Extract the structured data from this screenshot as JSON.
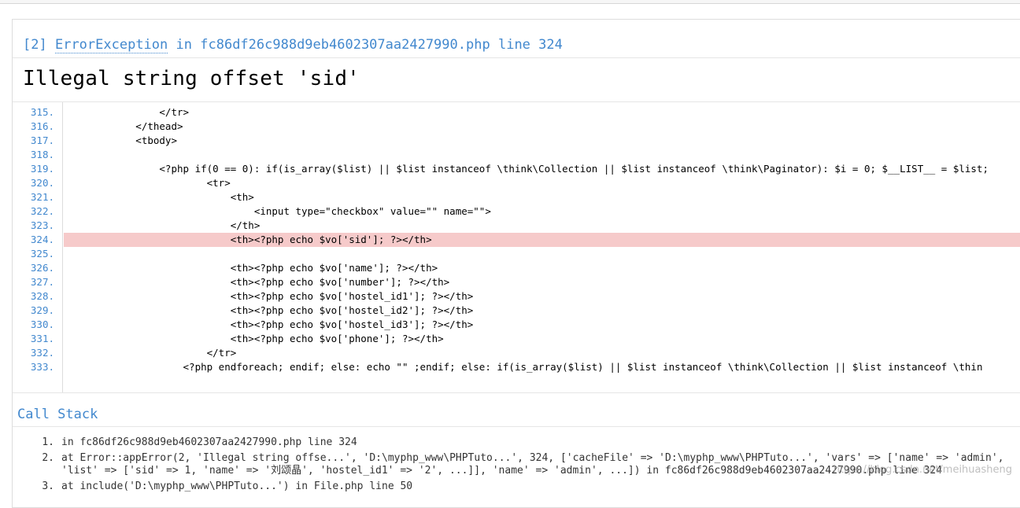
{
  "exception": {
    "code": "[2]",
    "class": "ErrorException",
    "in_word": "in",
    "file": "fc86df26c988d9eb4602307aa2427990.php",
    "line_label": "line 324",
    "message": "Illegal string offset 'sid'"
  },
  "source": {
    "highlight_line": "324.",
    "lines": [
      {
        "num": "315.",
        "text": "                </tr>"
      },
      {
        "num": "316.",
        "text": "            </thead>"
      },
      {
        "num": "317.",
        "text": "            <tbody>"
      },
      {
        "num": "318.",
        "text": ""
      },
      {
        "num": "319.",
        "text": "                <?php if(0 == 0): if(is_array($list) || $list instanceof \\think\\Collection || $list instanceof \\think\\Paginator): $i = 0; $__LIST__ = $list;"
      },
      {
        "num": "320.",
        "text": "                        <tr>"
      },
      {
        "num": "321.",
        "text": "                            <th>"
      },
      {
        "num": "322.",
        "text": "                                <input type=\"checkbox\" value=\"\" name=\"\">"
      },
      {
        "num": "323.",
        "text": "                            </th>"
      },
      {
        "num": "324.",
        "text": "                            <th><?php echo $vo['sid']; ?></th>"
      },
      {
        "num": "325.",
        "text": ""
      },
      {
        "num": "326.",
        "text": "                            <th><?php echo $vo['name']; ?></th>"
      },
      {
        "num": "327.",
        "text": "                            <th><?php echo $vo['number']; ?></th>"
      },
      {
        "num": "328.",
        "text": "                            <th><?php echo $vo['hostel_id1']; ?></th>"
      },
      {
        "num": "329.",
        "text": "                            <th><?php echo $vo['hostel_id2']; ?></th>"
      },
      {
        "num": "330.",
        "text": "                            <th><?php echo $vo['hostel_id3']; ?></th>"
      },
      {
        "num": "331.",
        "text": "                            <th><?php echo $vo['phone']; ?></th>"
      },
      {
        "num": "332.",
        "text": "                        </tr>"
      },
      {
        "num": "333.",
        "text": "                    <?php endforeach; endif; else: echo \"\" ;endif; else: if(is_array($list) || $list instanceof \\think\\Collection || $list instanceof \\thin"
      }
    ]
  },
  "call_stack": {
    "title": "Call Stack",
    "items": [
      {
        "num": "1.",
        "lines": [
          "in fc86df26c988d9eb4602307aa2427990.php line 324"
        ]
      },
      {
        "num": "2.",
        "lines": [
          "at Error::appError(2, 'Illegal string offse...', 'D:\\myphp_www\\PHPTuto...', 324, ['cacheFile' => 'D:\\myphp_www\\PHPTuto...', 'vars' => ['name' => 'admin',",
          "'list' => ['sid' => 1, 'name' => '刘颂晶', 'hostel_id1' => '2', ...]], 'name' => 'admin', ...]) in fc86df26c988d9eb4602307aa2427990.php line 324"
        ]
      },
      {
        "num": "3.",
        "lines": [
          "at include('D:\\myphp_www\\PHPTuto...') in File.php line 50"
        ]
      }
    ]
  },
  "watermark": "https://blog.csdn.net/meihuasheng",
  "colors": {
    "accent": "#4288ce",
    "highlight": "#f6caca"
  }
}
